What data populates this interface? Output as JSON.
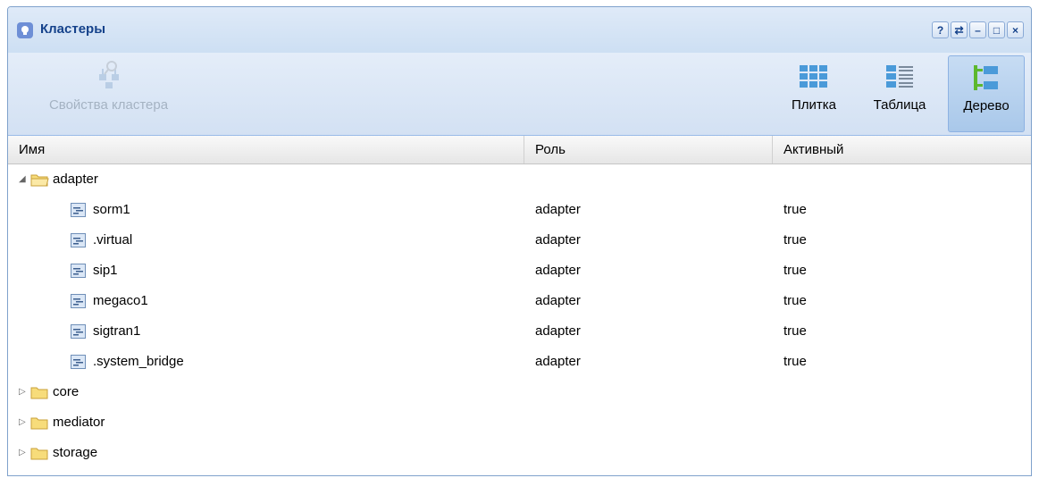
{
  "window": {
    "title": "Кластеры",
    "tools": [
      "?",
      "⇄",
      "–",
      "□",
      "×"
    ]
  },
  "toolbar": {
    "cluster_props_label": "Свойства кластера",
    "tile_label": "Плитка",
    "table_label": "Таблица",
    "tree_label": "Дерево"
  },
  "grid": {
    "columns": [
      "Имя",
      "Роль",
      "Активный"
    ],
    "folders": [
      {
        "name": "adapter",
        "expanded": true
      },
      {
        "name": "core",
        "expanded": false
      },
      {
        "name": "mediator",
        "expanded": false
      },
      {
        "name": "storage",
        "expanded": false
      }
    ],
    "adapter_children": [
      {
        "name": "sorm1",
        "role": "adapter",
        "active": "true"
      },
      {
        "name": ".virtual",
        "role": "adapter",
        "active": "true"
      },
      {
        "name": "sip1",
        "role": "adapter",
        "active": "true"
      },
      {
        "name": "megaco1",
        "role": "adapter",
        "active": "true"
      },
      {
        "name": "sigtran1",
        "role": "adapter",
        "active": "true"
      },
      {
        "name": ".system_bridge",
        "role": "adapter",
        "active": "true"
      }
    ]
  },
  "colors": {
    "title_text": "#15428b",
    "header_border": "#99bbe8",
    "folder_fill": "#f7dc7a",
    "folder_stroke": "#c9a13a"
  }
}
